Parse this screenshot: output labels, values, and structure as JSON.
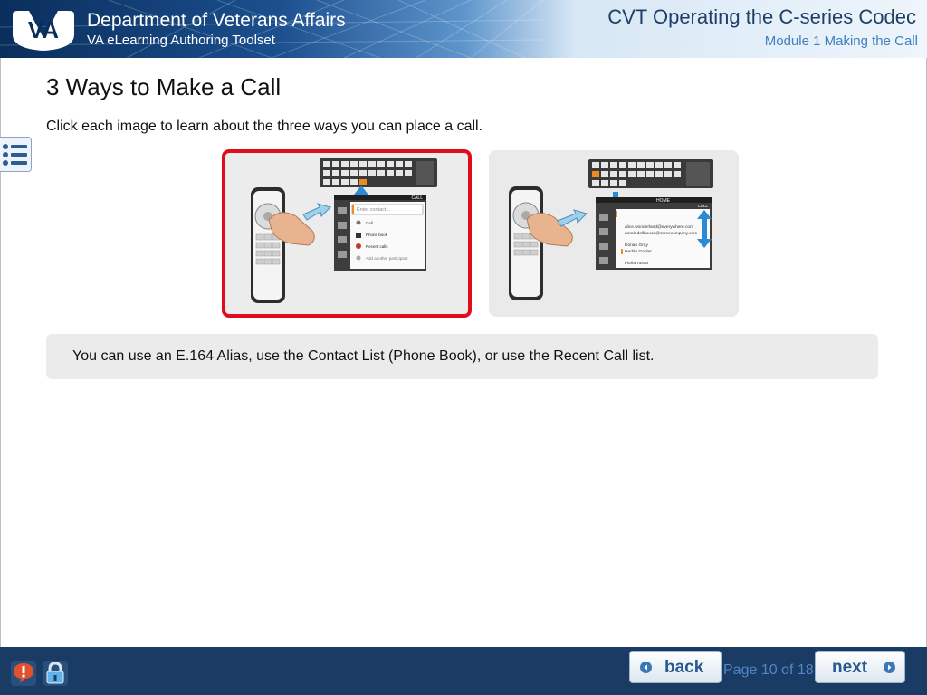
{
  "header": {
    "organization": "Department of Veterans Affairs",
    "toolset": "VA eLearning Authoring Toolset",
    "course_title": "CVT Operating the C-series Codec",
    "module_title": "Module 1 Making the Call",
    "logo_text": "VA"
  },
  "content": {
    "page_heading": "3 Ways to Make a Call",
    "instructions": "Click each image to learn about the three ways you can place a call.",
    "info_text": "You can use an E.164 Alias, use the Contact List (Phone Book), or use the Recent Call list."
  },
  "cards": [
    {
      "selected": true,
      "panel_title": "CALL",
      "search_placeholder": "Enter contact...",
      "menu_items": [
        "Call",
        "Phone book",
        "Recent calls",
        "Add another participant"
      ]
    },
    {
      "selected": false,
      "panel_title": "HOME",
      "panel_subtitle": "CALL",
      "contacts": [
        "alice.wonderland@everywhere.com",
        "norah.dollhouse@somecompany.com",
        "Dorian Gray",
        "Hedda Gabler",
        "Floria Tosca"
      ]
    }
  ],
  "navigation": {
    "back_label": "back",
    "next_label": "next",
    "page_counter": "Page 10 of 18"
  },
  "icons": {
    "menu": "list-menu-icon",
    "help": "exclamation-help-icon",
    "lock": "padlock-icon",
    "back": "circle-arrow-left-icon",
    "next": "circle-arrow-right-icon"
  },
  "colors": {
    "header_dark": "#0a2e5c",
    "footer": "#1a3b64",
    "selected_border": "#e10d1e",
    "accent_blue": "#3f7fc0"
  }
}
